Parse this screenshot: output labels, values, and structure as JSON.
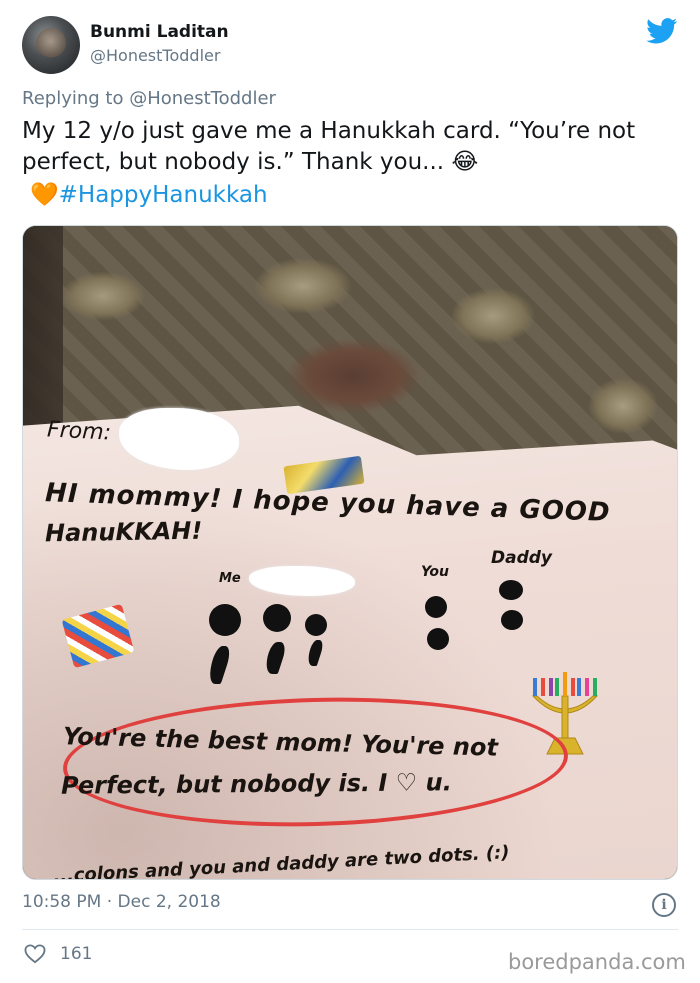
{
  "author": {
    "name": "Bunmi Laditan",
    "handle": "@HonestToddler"
  },
  "reply": {
    "prefix": "Replying to ",
    "handle": "@HonestToddler"
  },
  "tweet": {
    "text": "My 12 y/o just gave me a Hanukkah card. “You’re not perfect, but nobody is.” Thank you... 😂",
    "heart_emoji": "🧡",
    "hashtag": "#HappyHanukkah"
  },
  "card": {
    "from": "From:",
    "line1": "HI mommy! I hope you have a GOOD",
    "line2": "HanuKKAH!",
    "label_me": "Me",
    "label_you": "You",
    "label_daddy": "Daddy",
    "best_line1": "You're the best mom! You're not",
    "best_line2": "Perfect, but nobody is. I ♡ u.",
    "bottom_line": "...colons and you and daddy are two dots. (:)"
  },
  "meta": {
    "time": "10:58 PM · Dec 2, 2018",
    "info_symbol": "i"
  },
  "stats": {
    "likes": "161"
  },
  "watermark": "boredpanda.com",
  "colors": {
    "twitter_blue": "#1da1f2",
    "hashtag": "#1b95e0",
    "muted": "#657786",
    "circle_red": "#e0413f"
  },
  "icons": {
    "brand": "twitter-bird-icon",
    "like": "heart-icon",
    "info": "info-icon"
  }
}
